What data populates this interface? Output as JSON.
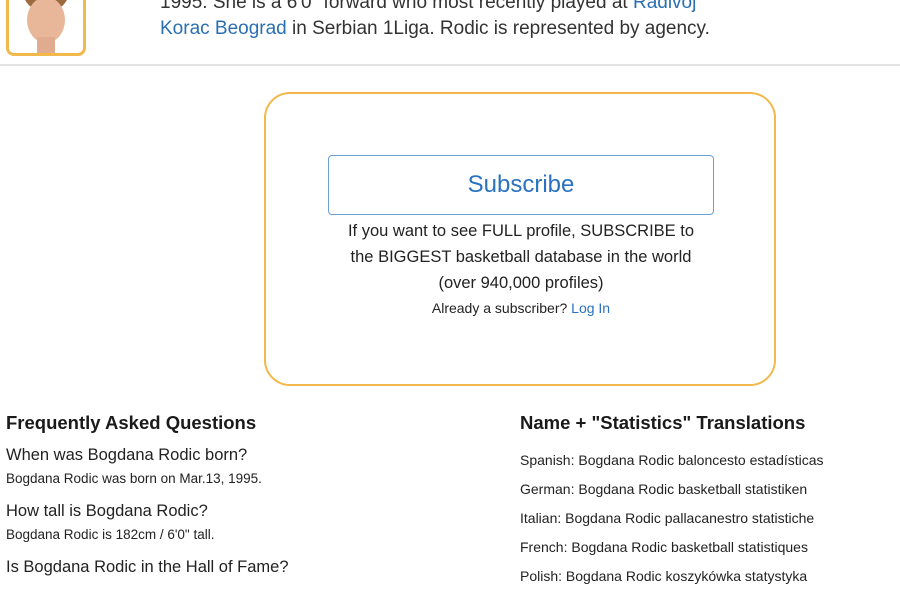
{
  "profile": {
    "bio_line1_prefix": "1995. She is a 6'0\" forward who most recently played at ",
    "bio_line1_link": "Radivoj",
    "bio_line2_link": "Korac Beograd",
    "bio_line2_suffix": " in Serbian 1Liga. Rodic is represented by agency."
  },
  "subscribe_box": {
    "button_label": "Subscribe",
    "pitch_line1": "If you want to see FULL profile, SUBSCRIBE to",
    "pitch_line2": "the BIGGEST basketball database in the world",
    "pitch_line3": "(over 940,000 profiles)",
    "already_text": "Already a subscriber? ",
    "login_label": "Log In"
  },
  "faq": {
    "title": "Frequently Asked Questions",
    "items": [
      {
        "q": "When was Bogdana Rodic born?",
        "a": "Bogdana Rodic was born on Mar.13, 1995."
      },
      {
        "q": "How tall is Bogdana Rodic?",
        "a": "Bogdana Rodic is 182cm / 6'0\" tall."
      },
      {
        "q": "Is Bogdana Rodic in the Hall of Fame?",
        "a": ""
      }
    ]
  },
  "translations": {
    "title": "Name + \"Statistics\" Translations",
    "items": [
      "Spanish: Bogdana Rodic baloncesto estadísticas",
      "German: Bogdana Rodic basketball statistiken",
      "Italian: Bogdana Rodic pallacanestro statistiche",
      "French: Bogdana Rodic basketball statistiques",
      "Polish: Bogdana Rodic koszykówka statystyka"
    ]
  },
  "colors": {
    "link": "#2a72c0",
    "card_border": "#f2b84b",
    "button_border": "#6a9fd6"
  }
}
